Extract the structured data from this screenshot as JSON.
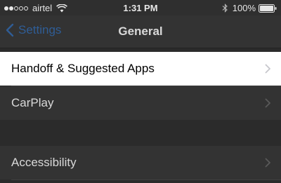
{
  "status_bar": {
    "carrier": "airtel",
    "signal_strength": 2,
    "signal_max": 5,
    "time": "1:31 PM",
    "battery_percent": "100%"
  },
  "nav": {
    "back_label": "Settings",
    "title": "General"
  },
  "rows": [
    {
      "label": "Handoff & Suggested Apps",
      "highlighted": true
    },
    {
      "label": "CarPlay",
      "highlighted": false
    },
    {
      "label": "Accessibility",
      "highlighted": false
    }
  ],
  "colors": {
    "accent": "#2f5d96",
    "background": "#2b2b2b",
    "row_background": "#333333",
    "highlight_background": "#ffffff"
  },
  "icons": [
    "wifi-icon",
    "bluetooth-icon",
    "battery-icon",
    "chevron-left-icon",
    "chevron-right-icon"
  ]
}
